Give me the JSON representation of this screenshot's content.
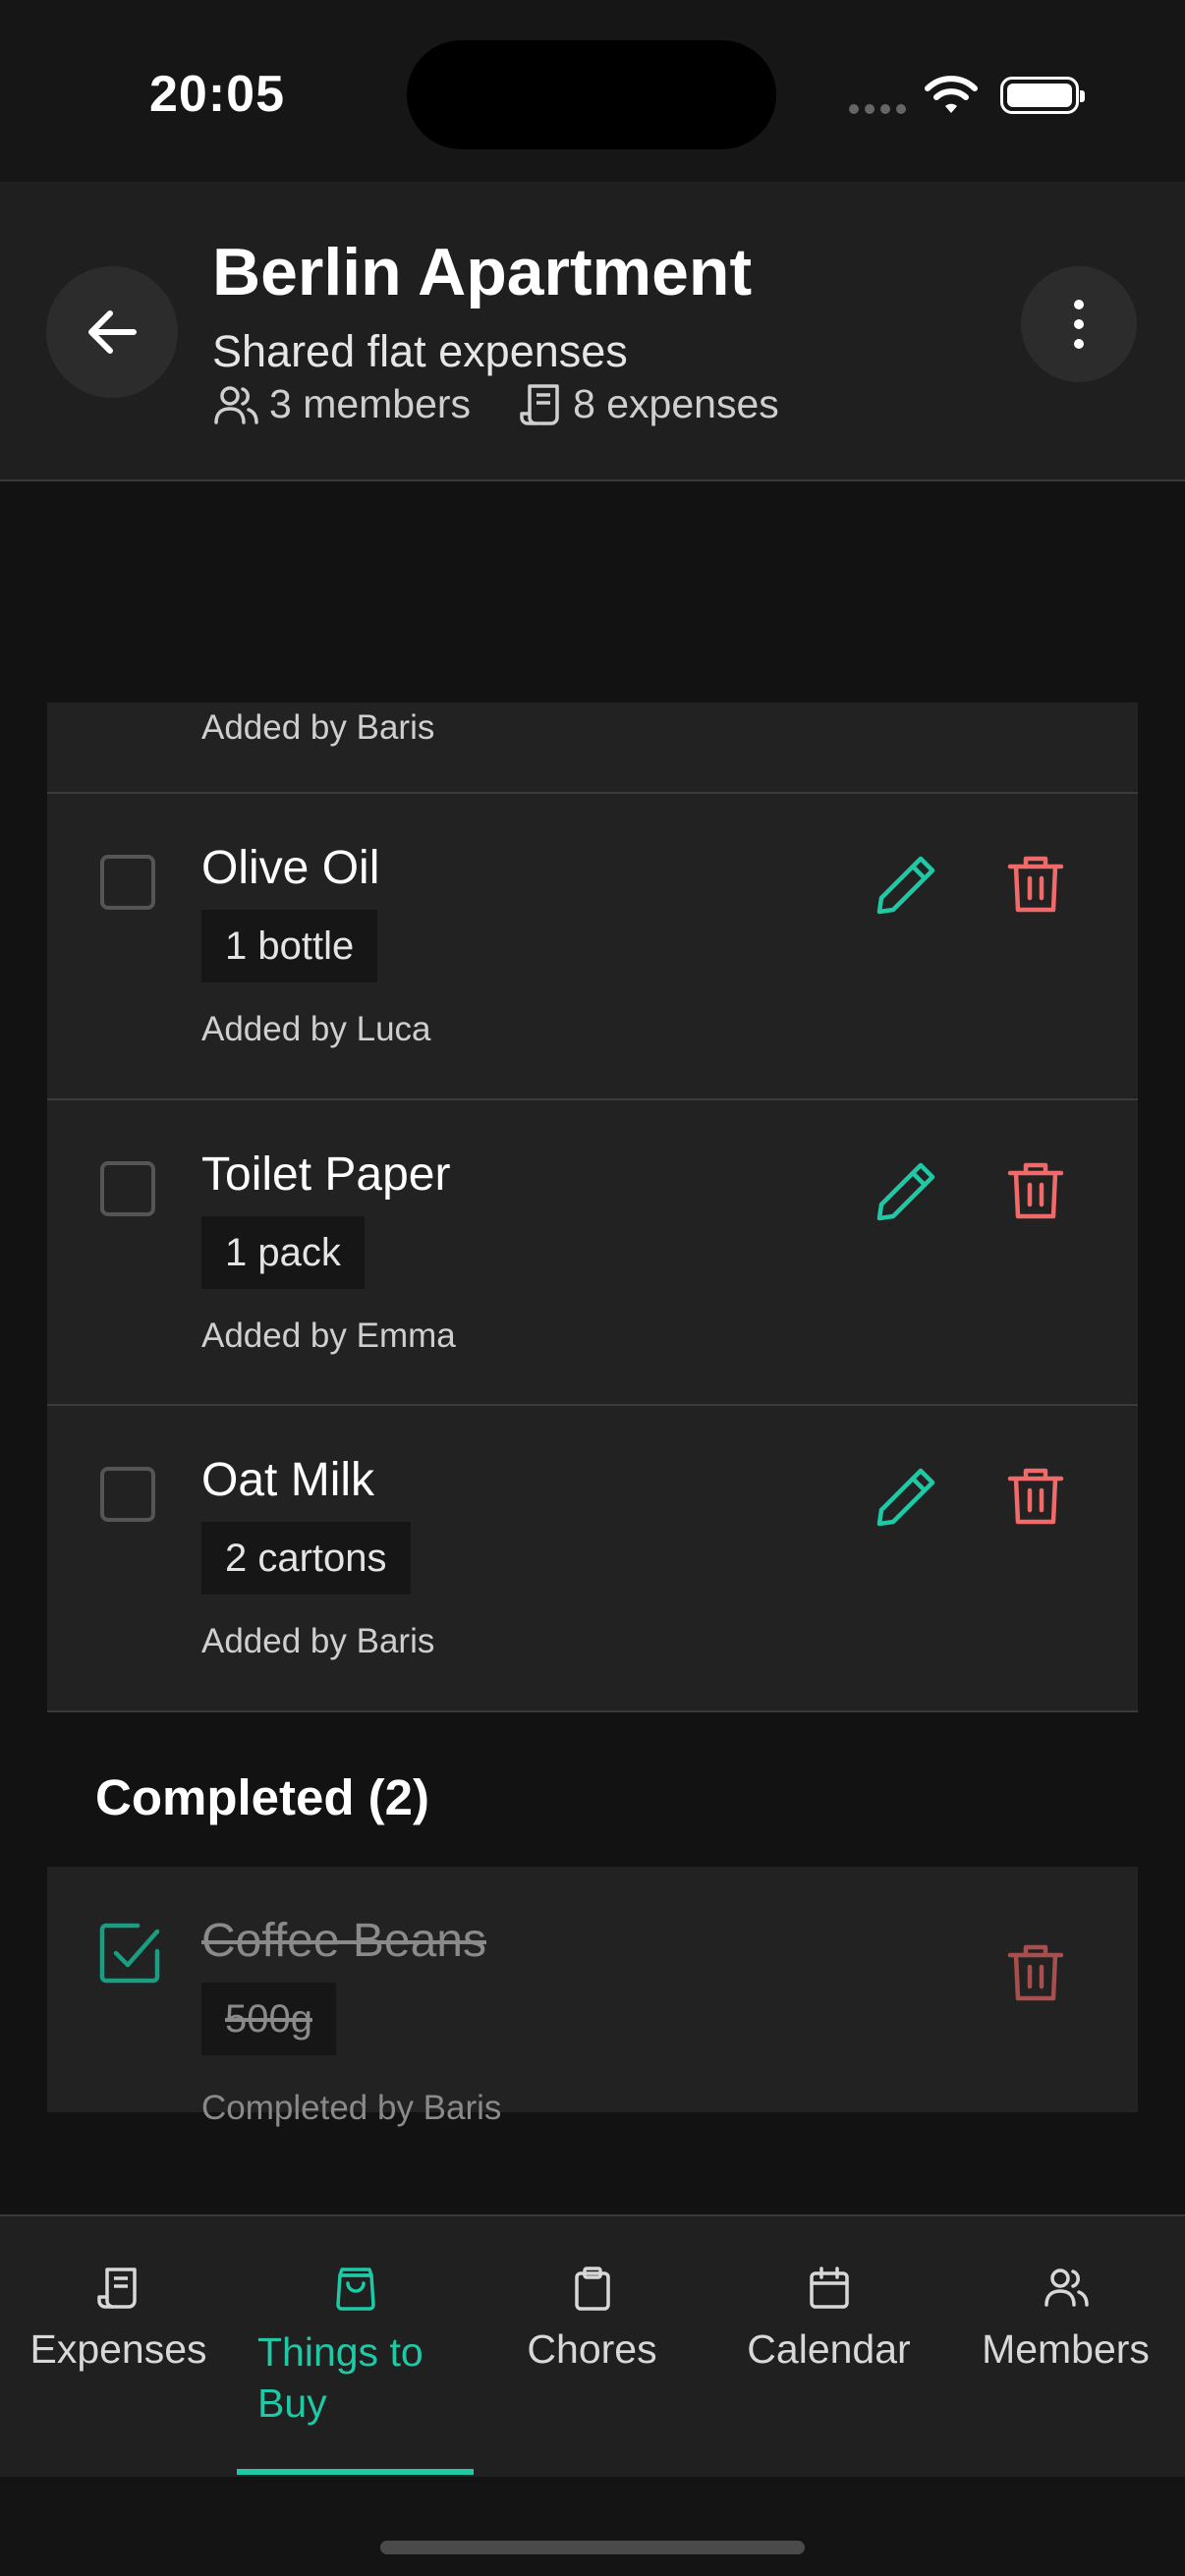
{
  "status_bar": {
    "time": "20:05"
  },
  "header": {
    "title": "Berlin Apartment",
    "subtitle": "Shared flat expenses",
    "members": "3 members",
    "expenses": "8 expenses"
  },
  "items": [
    {
      "name": "",
      "qty": "",
      "added": "Added by Baris"
    },
    {
      "name": "Olive Oil",
      "qty": "1 bottle",
      "added": "Added by Luca"
    },
    {
      "name": "Toilet Paper",
      "qty": "1 pack",
      "added": "Added by Emma"
    },
    {
      "name": "Oat Milk",
      "qty": "2 cartons",
      "added": "Added by Baris"
    }
  ],
  "completed": {
    "header": "Completed (2)",
    "items": [
      {
        "name": "Coffee Beans",
        "qty": "500g",
        "added": "Completed by Baris",
        "checked": true
      }
    ]
  },
  "tabs": [
    {
      "label": "Expenses",
      "icon": "receipt-icon"
    },
    {
      "label": "Things to Buy",
      "icon": "shopping-bag-icon",
      "active": true
    },
    {
      "label": "Chores",
      "icon": "clipboard-icon"
    },
    {
      "label": "Calendar",
      "icon": "calendar-icon"
    },
    {
      "label": "Members",
      "icon": "users-icon"
    }
  ],
  "colors": {
    "accent": "#1fc9a6",
    "danger": "#f06a6a",
    "background": "#121212",
    "card": "#222222"
  }
}
